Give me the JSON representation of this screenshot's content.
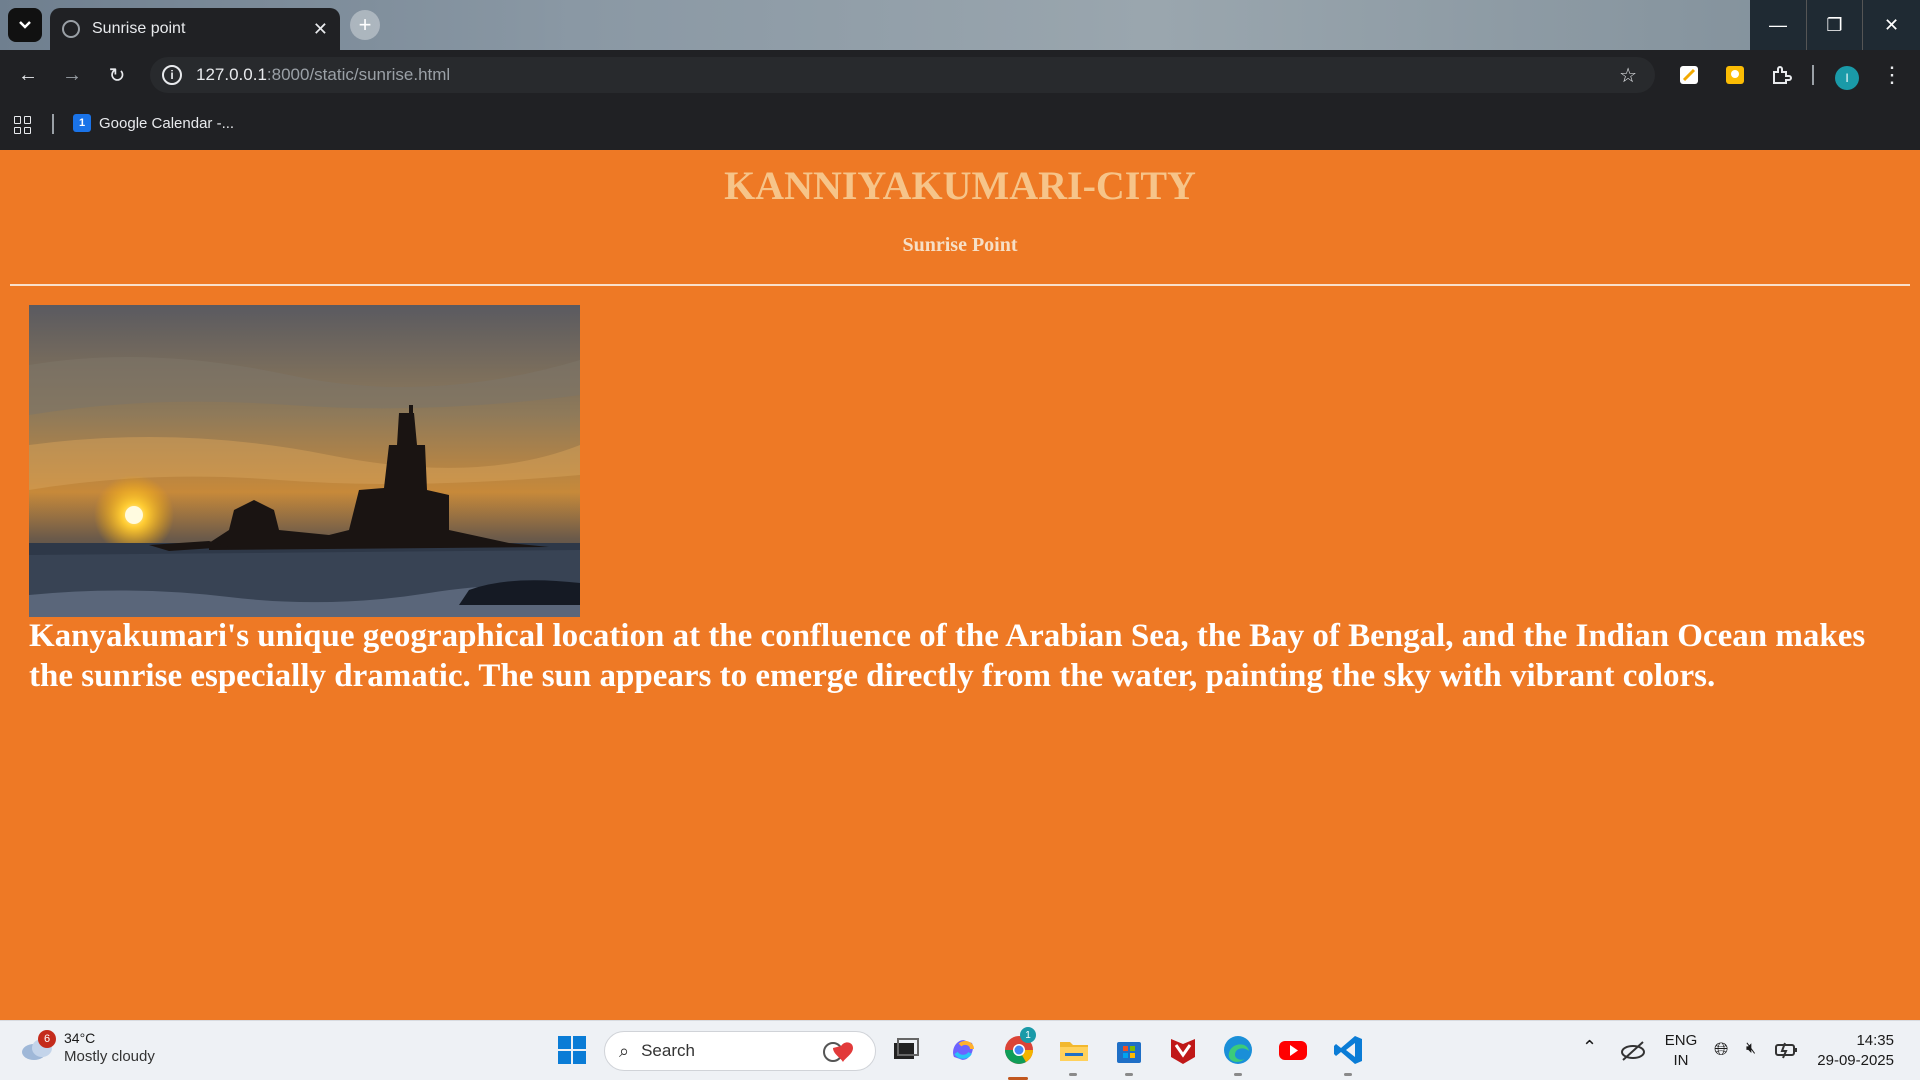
{
  "browser": {
    "tab_title": "Sunrise point",
    "url_host": "127.0.0.1",
    "url_path": ":8000/static/sunrise.html",
    "bookmark_label": "Google Calendar -...",
    "bookmark_icon_text": "1",
    "profile_initial": "I"
  },
  "page": {
    "title": "KANNIYAKUMARI-CITY",
    "subtitle": "Sunrise Point",
    "description": "Kanyakumari's unique geographical location at the confluence of the Arabian Sea, the Bay of Bengal, and the Indian Ocean makes the sunrise especially dramatic. The sun appears to emerge directly from the water, painting the sky with vibrant colors.",
    "background_color": "#ee7925",
    "title_color": "#f6c489"
  },
  "taskbar": {
    "weather_temp": "34°C",
    "weather_condition": "Mostly cloudy",
    "weather_badge": "6",
    "search_placeholder": "Search",
    "chrome_badge": "1",
    "lang_top": "ENG",
    "lang_bottom": "IN",
    "time": "14:35",
    "date": "29-09-2025"
  }
}
